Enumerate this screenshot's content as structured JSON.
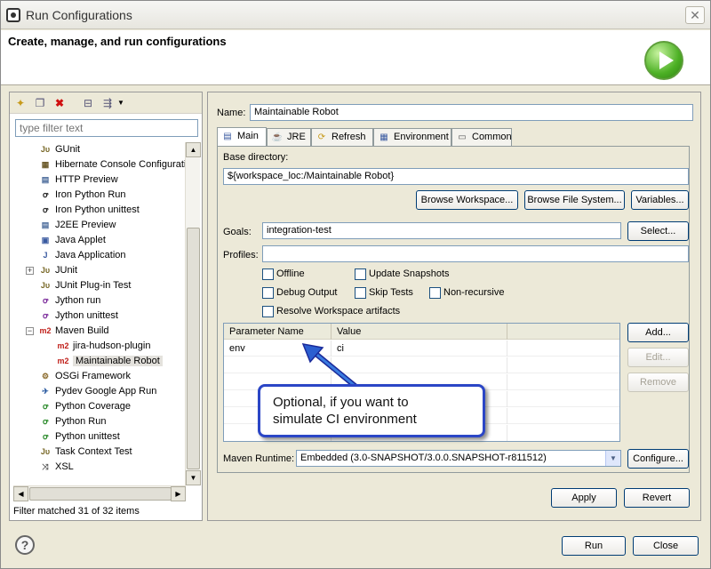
{
  "window": {
    "title": "Run Configurations",
    "close_symbol": "✕"
  },
  "banner": {
    "heading": "Create, manage, and run configurations"
  },
  "left": {
    "filter_placeholder": "type filter text",
    "tree": [
      {
        "label": "GUnit",
        "icon": "gunit-icon",
        "glyph": "Jυ",
        "color": "#7a6a2a"
      },
      {
        "label": "Hibernate Console Configuration",
        "icon": "hibernate-icon",
        "glyph": "▦",
        "color": "#6b5a2a"
      },
      {
        "label": "HTTP Preview",
        "icon": "http-icon",
        "glyph": "▤",
        "color": "#4a6a9a"
      },
      {
        "label": "Iron Python Run",
        "icon": "ironpython-icon",
        "glyph": "ꝍ",
        "color": "#222"
      },
      {
        "label": "Iron Python unittest",
        "icon": "ironpython-unittest-icon",
        "glyph": "ꝍ",
        "color": "#222"
      },
      {
        "label": "J2EE Preview",
        "icon": "j2ee-icon",
        "glyph": "▤",
        "color": "#4a6a9a"
      },
      {
        "label": "Java Applet",
        "icon": "applet-icon",
        "glyph": "▣",
        "color": "#3a5aa0"
      },
      {
        "label": "Java Application",
        "icon": "java-app-icon",
        "glyph": "J",
        "color": "#3a5aa0"
      },
      {
        "label": "JUnit",
        "icon": "junit-icon",
        "glyph": "Jυ",
        "color": "#7a6a2a"
      },
      {
        "label": "JUnit Plug-in Test",
        "icon": "junit-plugin-icon",
        "glyph": "Jυ",
        "color": "#7a6a2a"
      },
      {
        "label": "Jython run",
        "icon": "jython-icon",
        "glyph": "ꝍ",
        "color": "#7a2a9a"
      },
      {
        "label": "Jython unittest",
        "icon": "jython-unittest-icon",
        "glyph": "ꝍ",
        "color": "#7a2a9a"
      },
      {
        "label": "Maven Build",
        "icon": "maven-icon",
        "glyph": "m2",
        "color": "#c0201a"
      },
      {
        "label": "jira-hudson-plugin",
        "icon": "maven-icon",
        "glyph": "m2",
        "color": "#c0201a"
      },
      {
        "label": "Maintainable Robot",
        "icon": "maven-icon",
        "glyph": "m2",
        "color": "#c0201a"
      },
      {
        "label": "OSGi Framework",
        "icon": "osgi-icon",
        "glyph": "⚙",
        "color": "#8a6a2a"
      },
      {
        "label": "Pydev Google App Run",
        "icon": "pydev-google-icon",
        "glyph": "✈",
        "color": "#2a5aa0"
      },
      {
        "label": "Python Coverage",
        "icon": "python-coverage-icon",
        "glyph": "ꝍ",
        "color": "#2a8a2a"
      },
      {
        "label": "Python Run",
        "icon": "python-run-icon",
        "glyph": "ꝍ",
        "color": "#2a8a2a"
      },
      {
        "label": "Python unittest",
        "icon": "python-unittest-icon",
        "glyph": "ꝍ",
        "color": "#2a8a2a"
      },
      {
        "label": "Task Context Test",
        "icon": "task-context-icon",
        "glyph": "Jυ",
        "color": "#7a6a2a"
      },
      {
        "label": "XSL",
        "icon": "xsl-icon",
        "glyph": "⤨",
        "color": "#555"
      }
    ],
    "status": "Filter matched 31 of 32 items"
  },
  "main": {
    "name_label": "Name:",
    "name_value": "Maintainable Robot",
    "tabs": [
      {
        "label": "Main",
        "icon": "main-tab-icon",
        "glyph": "▤"
      },
      {
        "label": "JRE",
        "icon": "jre-tab-icon",
        "glyph": "☕"
      },
      {
        "label": "Refresh",
        "icon": "refresh-tab-icon",
        "glyph": "⟳"
      },
      {
        "label": "Environment",
        "icon": "environment-tab-icon",
        "glyph": "▦"
      },
      {
        "label": "Common",
        "icon": "common-tab-icon",
        "glyph": "▭"
      }
    ],
    "base_dir_label": "Base directory:",
    "base_dir_value": "${workspace_loc:/Maintainable Robot}",
    "browse_workspace": "Browse Workspace...",
    "browse_fs": "Browse File System...",
    "variables": "Variables...",
    "goals_label": "Goals:",
    "goals_value": "integration-test",
    "select": "Select...",
    "profiles_label": "Profiles:",
    "profiles_value": "",
    "checkboxes": {
      "offline": "Offline",
      "update_snapshots": "Update Snapshots",
      "debug_output": "Debug Output",
      "skip_tests": "Skip Tests",
      "non_recursive": "Non-recursive",
      "resolve_workspace": "Resolve Workspace artifacts"
    },
    "param_table": {
      "headers": [
        "Parameter Name",
        "Value"
      ],
      "rows": [
        [
          "env",
          "ci"
        ]
      ]
    },
    "add": "Add...",
    "edit": "Edit...",
    "remove": "Remove",
    "runtime_label": "Maven Runtime:",
    "runtime_value": "Embedded (3.0-SNAPSHOT/3.0.0.SNAPSHOT-r811512)",
    "configure": "Configure...",
    "apply": "Apply",
    "revert": "Revert"
  },
  "callout": {
    "line1": "Optional, if you want to",
    "line2": "simulate CI environment"
  },
  "footer": {
    "help": "?",
    "run": "Run",
    "close": "Close"
  }
}
